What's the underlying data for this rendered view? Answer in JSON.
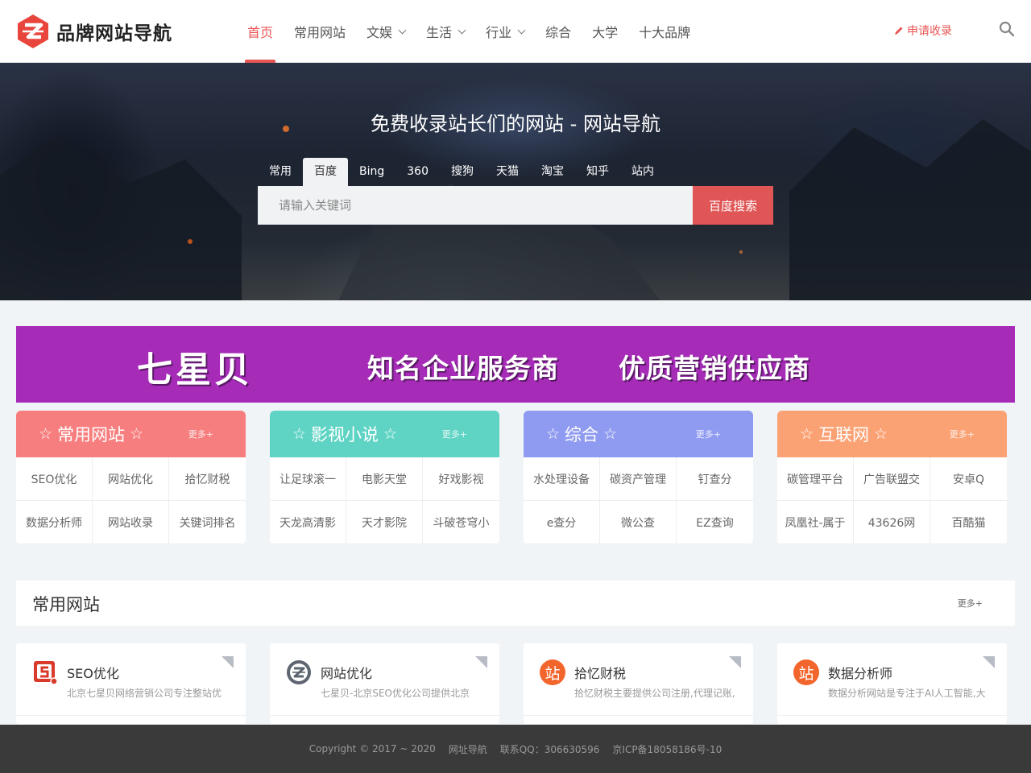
{
  "header": {
    "logo_text": "品牌网站导航",
    "nav": [
      {
        "label": "首页",
        "active": true,
        "dropdown": false
      },
      {
        "label": "常用网站",
        "active": false,
        "dropdown": false
      },
      {
        "label": "文娱",
        "active": false,
        "dropdown": true
      },
      {
        "label": "生活",
        "active": false,
        "dropdown": true
      },
      {
        "label": "行业",
        "active": false,
        "dropdown": true
      },
      {
        "label": "综合",
        "active": false,
        "dropdown": false
      },
      {
        "label": "大学",
        "active": false,
        "dropdown": false
      },
      {
        "label": "十大品牌",
        "active": false,
        "dropdown": false
      }
    ],
    "apply_label": "申请收录",
    "search_icon": "search-icon",
    "accent_color": "#e95454"
  },
  "hero": {
    "title": "免费收录站长们的网站 - 网站导航",
    "tabs": [
      "常用",
      "百度",
      "Bing",
      "360",
      "搜狗",
      "天猫",
      "淘宝",
      "知乎",
      "站内"
    ],
    "active_tab": "百度",
    "search_placeholder": "请输入关键词",
    "search_value": "",
    "search_button": "百度搜索"
  },
  "banner": {
    "brand": "七星贝",
    "slogan1": "知名企业服务商",
    "slogan2": "优质营销供应商",
    "background": "#a62cb8"
  },
  "categories": [
    {
      "title": "常用网站",
      "more": "更多+",
      "color": "#f77e7e",
      "items": [
        "SEO优化",
        "网站优化",
        "拾忆财税",
        "数据分析师",
        "网站收录",
        "关键词排名"
      ]
    },
    {
      "title": "影视小说",
      "more": "更多+",
      "color": "#5fd4c4",
      "items": [
        "让足球滚一",
        "电影天堂",
        "好戏影视",
        "天龙高清影",
        "天才影院",
        "斗破苍穹小"
      ]
    },
    {
      "title": "综合",
      "more": "更多+",
      "color": "#8f9bf0",
      "items": [
        "水处理设备",
        "碳资产管理",
        "钉查分",
        "e查分",
        "微公查",
        "EZ查询"
      ]
    },
    {
      "title": "互联网",
      "more": "更多+",
      "color": "#fba275",
      "items": [
        "碳管理平台",
        "广告联盟交",
        "安卓Q",
        "凤凰社-属于",
        "43626网",
        "百酷猫"
      ]
    }
  ],
  "section": {
    "title": "常用网站",
    "more": "更多+"
  },
  "sites": [
    {
      "name": "SEO优化",
      "desc": "北京七星贝网络营销公司专注整站优",
      "icon": "seo-s-icon"
    },
    {
      "name": "网站优化",
      "desc": "七星贝-北京SEO优化公司提供北京",
      "icon": "z-logo-icon"
    },
    {
      "name": "拾忆财税",
      "desc": "拾忆财税主要提供公司注册,代理记账,",
      "icon": "zhan-icon",
      "glyph": "站"
    },
    {
      "name": "数据分析师",
      "desc": "数据分析网站是专注于AI人工智能,大",
      "icon": "zhan-icon",
      "glyph": "站"
    }
  ],
  "footer": {
    "copyright": "Copyright © 2017 ~ 2020",
    "link": "网址导航",
    "qq": "联系QQ：306630596",
    "icp": "京ICP备18058186号-10"
  }
}
